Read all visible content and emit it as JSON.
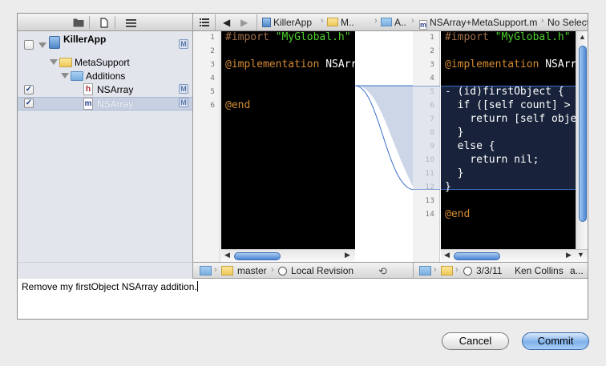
{
  "navigator": {
    "project": {
      "label": "KillerApp",
      "badge": "M"
    },
    "items": [
      {
        "label": "MetaSupport"
      },
      {
        "label": "Additions"
      },
      {
        "label": "NSArray",
        "filetype": "h",
        "checked": true,
        "badge": "M"
      },
      {
        "label": "NSArray",
        "filetype": "m",
        "checked": true,
        "badge": "M",
        "selected": true
      }
    ],
    "toolbar_icons": [
      "folder-icon",
      "document-icon",
      "list-icon"
    ]
  },
  "jumpbar": {
    "crumbs": [
      "KillerApp",
      "M..",
      "A..",
      "NSArray+MetaSupport.m",
      "No Selection"
    ]
  },
  "left_editor": {
    "line_numbers": [
      "1",
      "2",
      "3",
      "4",
      "5",
      "6"
    ],
    "lines": [
      {
        "pre": "#import ",
        "str": "\"MyGlobal.h\""
      },
      {
        "text": ""
      },
      {
        "kw": "@implementation",
        "rest": " NSArr"
      },
      {
        "text": ""
      },
      {
        "text": ""
      },
      {
        "kw": "@end"
      }
    ]
  },
  "right_editor": {
    "line_numbers": [
      "1",
      "2",
      "3",
      "4",
      "5",
      "6",
      "7",
      "8",
      "9",
      "10",
      "11",
      "12",
      "13",
      "14"
    ],
    "lines": [
      {
        "pre": "#import ",
        "str": "\"MyGlobal.h\""
      },
      {
        "text": ""
      },
      {
        "kw": "@implementation",
        "rest": " NSArr"
      },
      {
        "text": ""
      },
      {
        "text": "- (id)firstObject {"
      },
      {
        "text": "  if ([self count] >"
      },
      {
        "text": "    return [self obje"
      },
      {
        "text": "  }"
      },
      {
        "text": "  else {"
      },
      {
        "text": "    return nil;"
      },
      {
        "text": "  }"
      },
      {
        "text": "}"
      },
      {
        "text": ""
      },
      {
        "kw": "@end"
      }
    ]
  },
  "bottombar": {
    "left_branch": "master",
    "left_revision": "Local Revision",
    "right_date": "3/3/11",
    "right_author": "Ken Collins",
    "right_more": "a..."
  },
  "commit_message": "Remove my firstObject NSArray addition.",
  "buttons": {
    "cancel": "Cancel",
    "commit": "Commit"
  }
}
